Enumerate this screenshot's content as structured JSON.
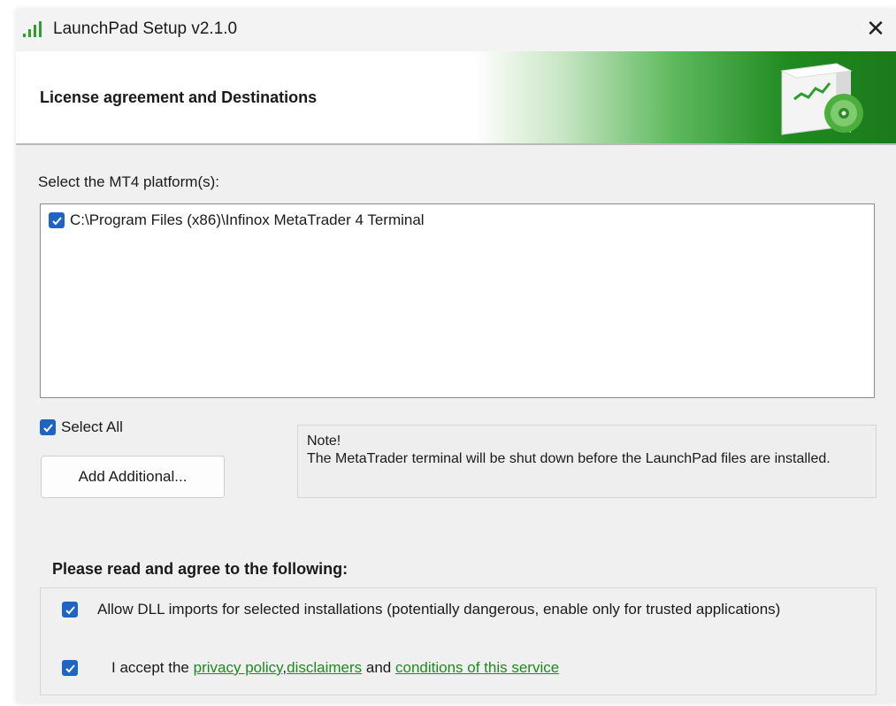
{
  "window": {
    "title": "LaunchPad Setup v2.1.0",
    "close_symbol": "✕"
  },
  "banner": {
    "title": "License agreement and Destinations"
  },
  "platforms": {
    "label": "Select the MT4 platform(s):",
    "items": [
      {
        "path": "C:\\Program Files (x86)\\Infinox MetaTrader 4 Terminal",
        "checked": true
      }
    ]
  },
  "controls": {
    "select_all_label": "Select All",
    "select_all_checked": true,
    "add_button_label": "Add Additional..."
  },
  "note": {
    "title": "Note!",
    "text": "The MetaTrader terminal will be shut down before the LaunchPad files are installed."
  },
  "agreement": {
    "heading": "Please read and agree to the following:",
    "dll_label": "Allow DLL imports for selected installations (potentially dangerous, enable only for trusted applications)",
    "dll_checked": true,
    "accept_prefix": "I accept the ",
    "privacy_link": "privacy policy",
    "comma": ",",
    "disclaimers_link": "disclaimers",
    "and_text": " and ",
    "conditions_link": "conditions of this service",
    "accept_checked": true
  },
  "colors": {
    "checkbox": "#1f63c3",
    "link": "#1e8a1e",
    "banner_green": "#1f8a1f"
  }
}
